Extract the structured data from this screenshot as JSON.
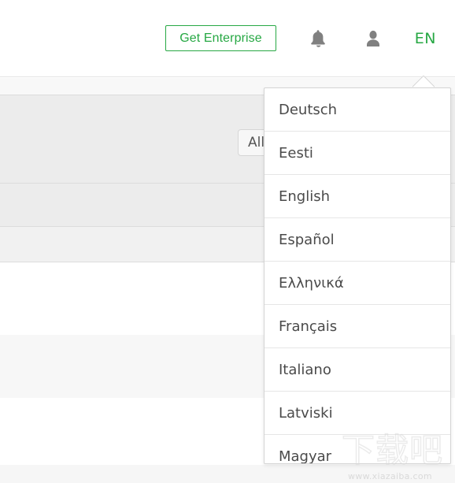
{
  "header": {
    "enterprise_button_label": "Get Enterprise",
    "notifications_icon": "bell-icon",
    "account_icon": "user-icon",
    "language_code": "EN",
    "accent_color": "#27a844",
    "icon_color": "#808080"
  },
  "page_body": {
    "filter_button_label": "All"
  },
  "language_dropdown": {
    "selected": "English",
    "items": [
      {
        "label": "Deutsch"
      },
      {
        "label": "Eesti"
      },
      {
        "label": "English"
      },
      {
        "label": "Español"
      },
      {
        "label": "Ελληνικά"
      },
      {
        "label": "Français"
      },
      {
        "label": "Italiano"
      },
      {
        "label": "Latviski"
      },
      {
        "label": "Magyar"
      }
    ]
  },
  "watermark": {
    "glyphs": "下载吧",
    "url": "www.xiazaiba.com"
  }
}
